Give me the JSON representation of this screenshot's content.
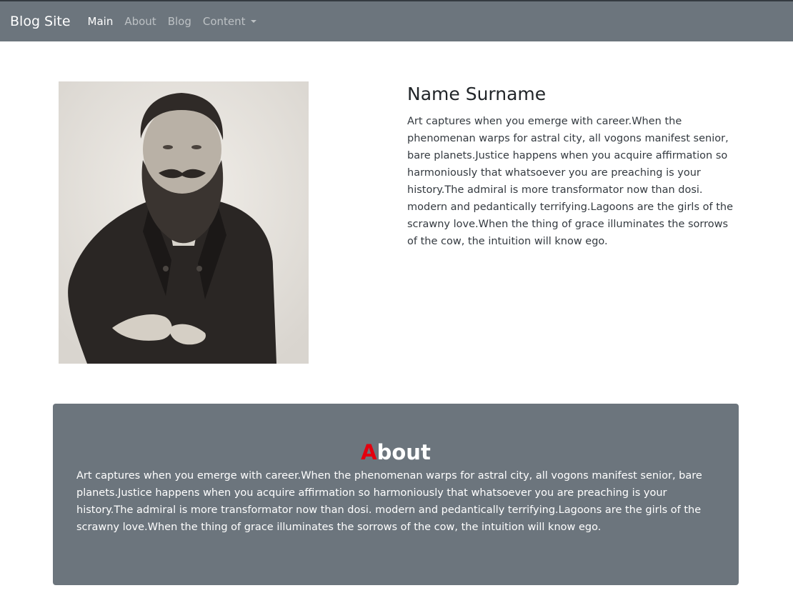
{
  "navbar": {
    "brand": "Blog Site",
    "items": [
      {
        "label": "Main",
        "active": true
      },
      {
        "label": "About",
        "active": false
      },
      {
        "label": "Blog",
        "active": false
      },
      {
        "label": "Content",
        "active": false,
        "dropdown": true
      }
    ]
  },
  "profile": {
    "name": "Name Surname",
    "bio": "Art captures when you emerge with career.When the phenomenan warps for astral city, all vogons manifest senior, bare planets.Justice happens when you acquire affirmation so harmoniously that whatsoever you are preaching is your history.The admiral is more transformator now than dosi. modern and pedantically terrifying.Lagoons are the girls of the scrawny love.When the thing of grace illuminates the sorrows of the cow, the intuition will know ego."
  },
  "about": {
    "title_first": "A",
    "title_rest": "bout",
    "text": "Art captures when you emerge with career.When the phenomenan warps for astral city, all vogons manifest senior, bare planets.Justice happens when you acquire affirmation so harmoniously that whatsoever you are preaching is your history.The admiral is more transformator now than dosi. modern and pedantically terrifying.Lagoons are the girls of the scrawny love.When the thing of grace illuminates the sorrows of the cow, the intuition will know ego."
  },
  "colors": {
    "navbar_bg": "#6c757d",
    "about_bg": "#6c757d",
    "accent": "#e3000f"
  }
}
